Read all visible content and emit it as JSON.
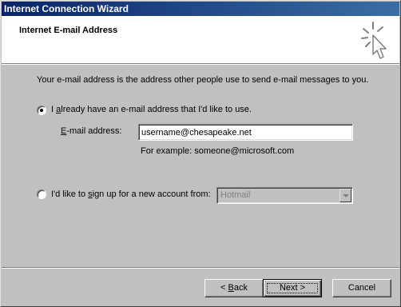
{
  "window": {
    "title": "Internet Connection Wizard"
  },
  "header": {
    "title": "Internet E-mail Address",
    "icon": "wizard-cursor-icon"
  },
  "intro_text": "Your e-mail address is the address other people use to send e-mail messages to you.",
  "option_existing": {
    "label_prefix": "I ",
    "label_mnemonic": "a",
    "label_suffix": "lready have an e-mail address that I'd like to use.",
    "selected": true
  },
  "email_field": {
    "label_mnemonic": "E",
    "label_rest": "-mail address:",
    "value": "username@chesapeake.net"
  },
  "example_text": "For example: someone@microsoft.com",
  "option_signup": {
    "label_prefix": "I'd like to ",
    "label_mnemonic": "s",
    "label_suffix": "ign up for a new account from:",
    "selected": false
  },
  "provider_select": {
    "value": "Hotmail",
    "enabled": false
  },
  "buttons": {
    "back_prefix": "< ",
    "back_mnemonic": "B",
    "back_rest": "ack",
    "next_label": "Next >",
    "cancel_label": "Cancel"
  }
}
